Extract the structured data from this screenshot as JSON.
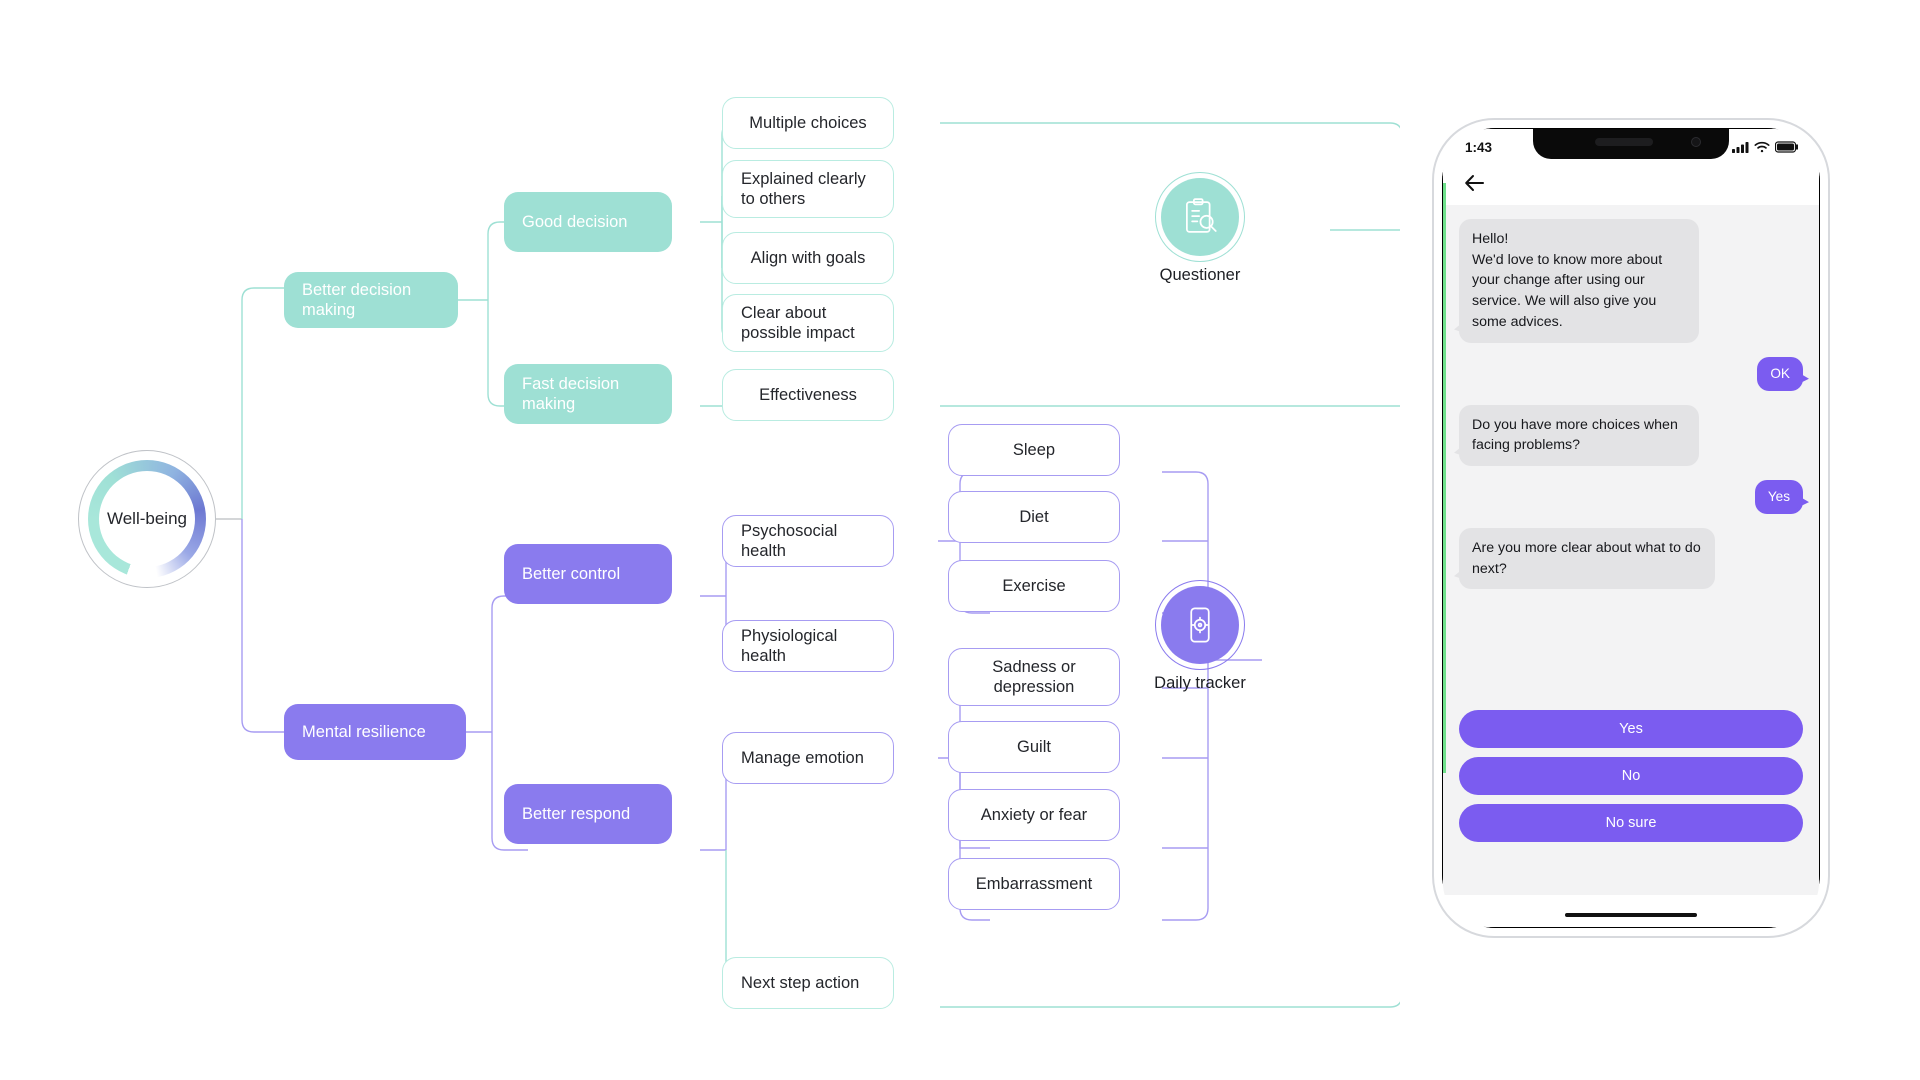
{
  "mindmap": {
    "root": {
      "label": "Well-being"
    },
    "branches": [
      {
        "id": "better-decision-making",
        "label": "Better decision making",
        "color": "#9ee0d4"
      },
      {
        "id": "mental-resilience",
        "label": "Mental resilience",
        "color": "#8a7bee"
      }
    ],
    "sub_branches": [
      {
        "id": "good-decision",
        "label": "Good decision",
        "color": "#9ee0d4"
      },
      {
        "id": "fast-decision-making",
        "label": "Fast decision making",
        "color": "#9ee0d4"
      },
      {
        "id": "better-control",
        "label": "Better control",
        "color": "#8a7bee"
      },
      {
        "id": "better-respond",
        "label": "Better respond",
        "color": "#8a7bee"
      }
    ],
    "mid_nodes": [
      {
        "id": "psychosocial-health",
        "label": "Psychosocial health"
      },
      {
        "id": "physiological-health",
        "label": "Physiological health"
      },
      {
        "id": "manage-emotion",
        "label": "Manage emotion"
      },
      {
        "id": "next-step-action",
        "label": "Next step action"
      }
    ],
    "leaves_teal": [
      {
        "id": "multiple-choices",
        "label": "Multiple choices"
      },
      {
        "id": "explained-clearly-to-others",
        "label": "Explained clearly to others"
      },
      {
        "id": "align-with-goals",
        "label": "Align with goals"
      },
      {
        "id": "clear-about-possible-impact",
        "label": "Clear about possible impact"
      },
      {
        "id": "effectiveness",
        "label": "Effectiveness"
      }
    ],
    "leaves_purple": [
      {
        "id": "sleep",
        "label": "Sleep"
      },
      {
        "id": "diet",
        "label": "Diet"
      },
      {
        "id": "exercise",
        "label": "Exercise"
      },
      {
        "id": "sadness-or-depression",
        "label": "Sadness or depression"
      },
      {
        "id": "guilt",
        "label": "Guilt"
      },
      {
        "id": "anxiety-or-fear",
        "label": "Anxiety or fear"
      },
      {
        "id": "embarrassment",
        "label": "Embarrassment"
      }
    ],
    "endpoints": [
      {
        "id": "questioner",
        "label": "Questioner",
        "icon": "clipboard-search-icon",
        "color": "#9ee0d4"
      },
      {
        "id": "daily-tracker",
        "label": "Daily tracker",
        "icon": "phone-target-icon",
        "color": "#8a7bee"
      }
    ]
  },
  "phone": {
    "status": {
      "time": "1:43",
      "signal_icon": "cellular-signal-icon",
      "wifi_icon": "wifi-icon",
      "battery_icon": "battery-icon"
    },
    "navbar": {
      "back_icon": "back-arrow-icon"
    },
    "messages": [
      {
        "from": "them",
        "text": "Hello!\nWe'd love to know more about your change after using our service. We will also give you some advices."
      },
      {
        "from": "me",
        "text": "OK"
      },
      {
        "from": "them",
        "text": "Do you have more choices when facing problems?"
      },
      {
        "from": "me",
        "text": "Yes"
      },
      {
        "from": "them",
        "text": "Are you more clear about what to do next?"
      }
    ],
    "actions": [
      {
        "id": "yes",
        "label": "Yes"
      },
      {
        "id": "no",
        "label": "No"
      },
      {
        "id": "no-sure",
        "label": "No sure"
      }
    ],
    "accent_color": "#7b5cf0",
    "bubble_them_color": "#e3e3e5"
  }
}
